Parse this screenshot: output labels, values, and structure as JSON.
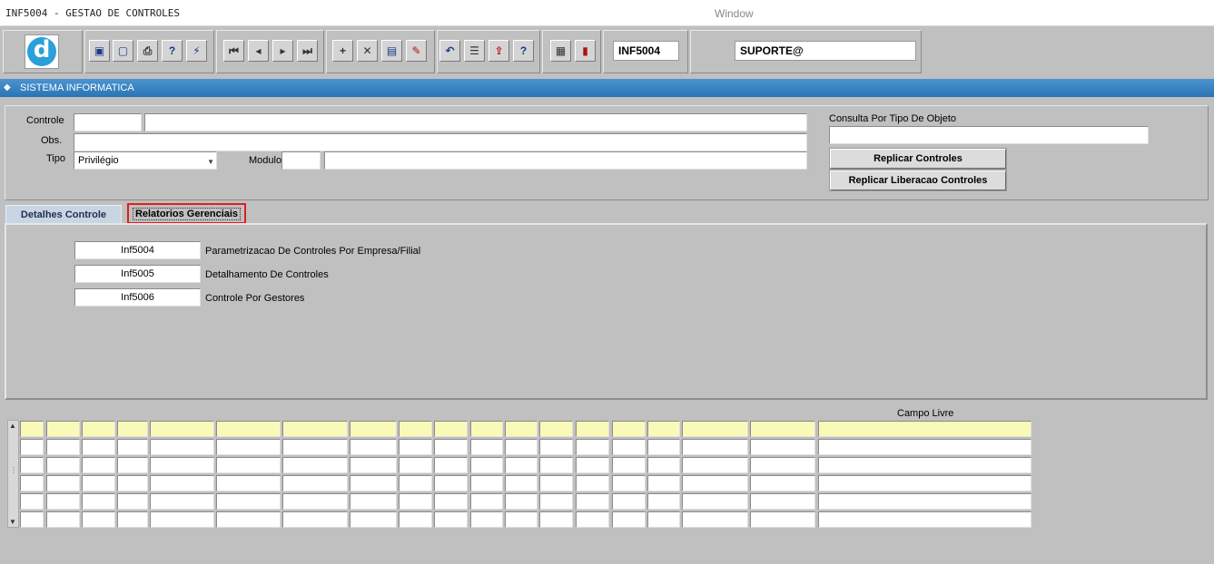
{
  "window": {
    "title": "INF5004 - GESTAO DE CONTROLES",
    "menu_label": "Window"
  },
  "toolbar": {
    "logo_letter": "d",
    "form_code": "INF5004",
    "user": "SUPORTE@",
    "icons": [
      "save-icon",
      "print-preview-icon",
      "print-icon",
      "query-icon",
      "execute-query-icon",
      "first-record-icon",
      "previous-record-icon",
      "next-record-icon",
      "last-record-icon",
      "insert-record-icon",
      "delete-record-icon",
      "clear-icon",
      "edit-icon",
      "undo-icon",
      "list-icon",
      "export-icon",
      "help-icon",
      "menu-icon",
      "exit-icon"
    ]
  },
  "section": {
    "title": "SISTEMA INFORMATICA"
  },
  "form": {
    "controle_label": "Controle",
    "controle_code": "",
    "controle_desc": "",
    "obs_label": "Obs.",
    "obs_value": "",
    "tipo_label": "Tipo",
    "tipo_value": "Privilégio",
    "modulo_label": "Modulo",
    "modulo_code": "",
    "modulo_desc": "",
    "consulta_label": "Consulta Por Tipo De Objeto",
    "consulta_value": "",
    "replicar_controles": "Replicar Controles",
    "replicar_liberacao": "Replicar Liberacao Controles"
  },
  "tabs": [
    {
      "label": "Detalhes Controle",
      "active": false
    },
    {
      "label": "Relatorios Gerenciais",
      "active": true
    }
  ],
  "reports": [
    {
      "code": "Inf5004",
      "desc": "Parametrizacao De Controles Por Empresa/Filial"
    },
    {
      "code": "Inf5005",
      "desc": "Detalhamento De Controles"
    },
    {
      "code": "Inf5006",
      "desc": "Controle Por Gestores"
    }
  ],
  "grid": {
    "campo_livre_label": "Campo Livre",
    "rows": 6
  }
}
